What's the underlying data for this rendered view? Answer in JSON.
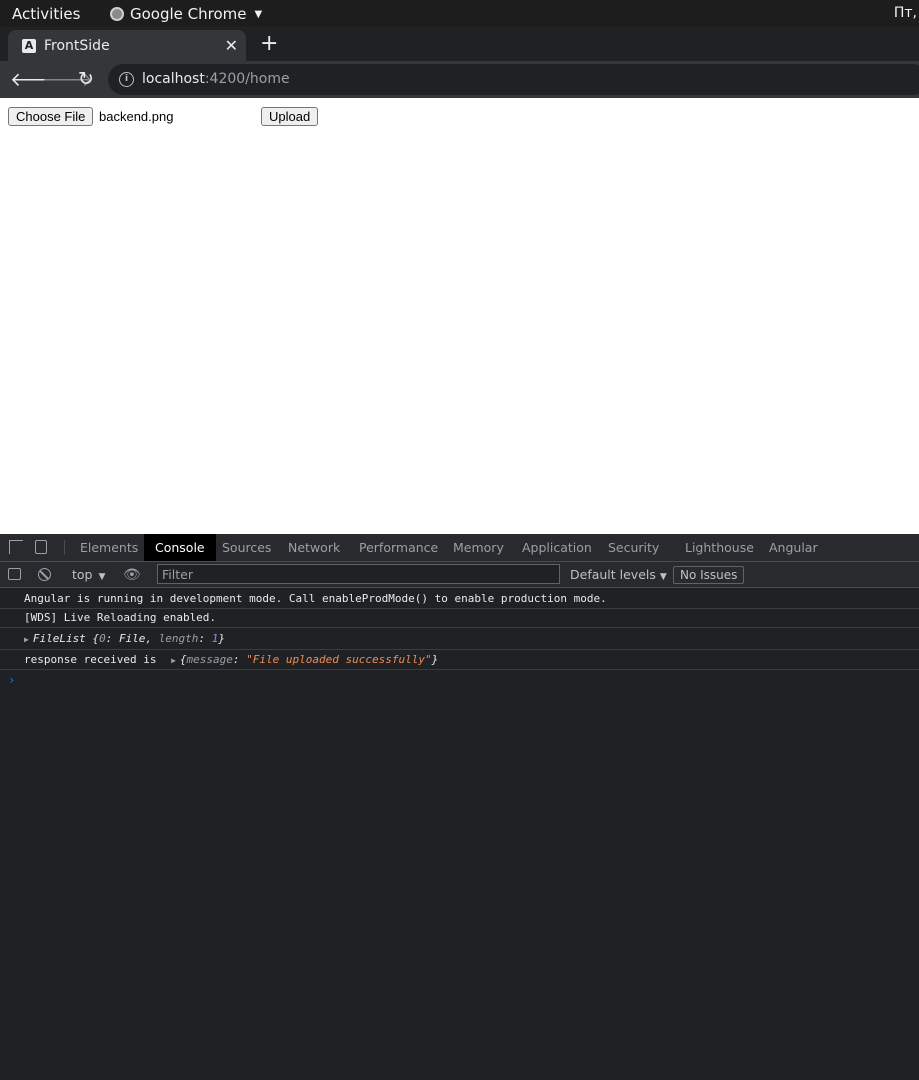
{
  "os_bar": {
    "activities": "Activities",
    "app_name": "Google Chrome",
    "clock": "Пт,"
  },
  "browser": {
    "tab_title": "FrontSide",
    "tab_favicon": "A",
    "close_glyph": "✕",
    "newtab_glyph": "+",
    "url_host": "localhost",
    "url_path": ":4200/home"
  },
  "page": {
    "choose_file_label": "Choose File",
    "file_name": "backend.png",
    "upload_label": "Upload"
  },
  "devtools": {
    "tabs": [
      "Elements",
      "Console",
      "Sources",
      "Network",
      "Performance",
      "Memory",
      "Application",
      "Security",
      "Lighthouse",
      "Angular"
    ],
    "active_tab": "Console",
    "context": "top",
    "filter_placeholder": "Filter",
    "levels": "Default levels",
    "issues": "No Issues",
    "logs": {
      "l1": "Angular is running in development mode. Call enableProdMode() to enable production mode.",
      "l2": "[WDS] Live Reloading enabled.",
      "l3_obj": "FileList",
      "l3_open": " {",
      "l3_k0": "0",
      "l3_v0": "File",
      "l3_k1": "length",
      "l3_v1": "1",
      "l3_close": "}",
      "l4_prefix": "response received is",
      "l4_key": "message",
      "l4_val": "\"File uploaded successfully\""
    },
    "prompt_glyph": "›"
  },
  "colors": {
    "accent_blue": "#1a73e8",
    "string_orange": "#f28b54",
    "number_purple": "#9980ff",
    "devtools_bg": "#202124"
  }
}
